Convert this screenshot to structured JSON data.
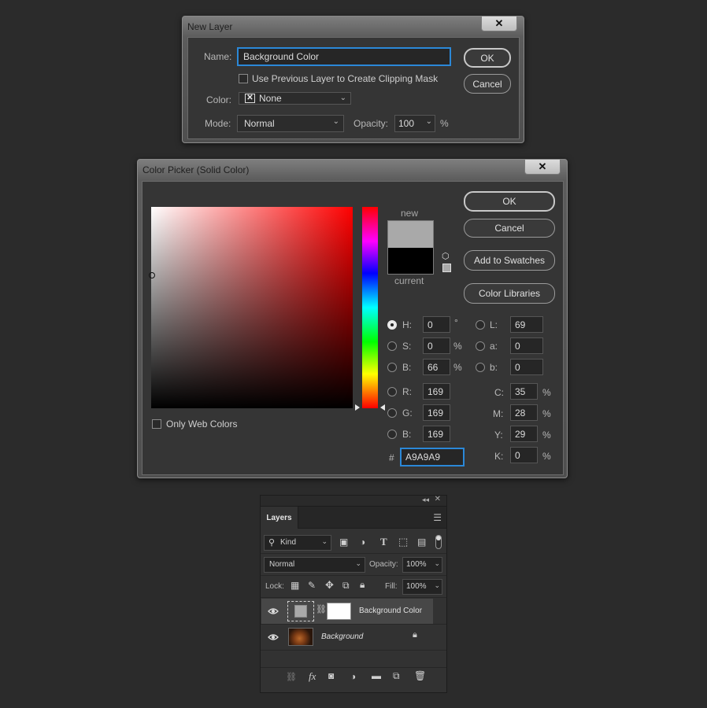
{
  "new_layer": {
    "title": "New Layer",
    "close": "✕",
    "name_label": "Name:",
    "name_value": "Background Color",
    "clip_label": "Use Previous Layer to Create Clipping Mask",
    "color_label": "Color:",
    "color_value": "None",
    "mode_label": "Mode:",
    "mode_value": "Normal",
    "opacity_label": "Opacity:",
    "opacity_value": "100",
    "opacity_unit": "%",
    "ok": "OK",
    "cancel": "Cancel"
  },
  "color_picker": {
    "title": "Color Picker (Solid Color)",
    "close": "✕",
    "new_label": "new",
    "current_label": "current",
    "new_color": "#a9a9a9",
    "current_color": "#000000",
    "hue_color": "#ff0000",
    "ok": "OK",
    "cancel": "Cancel",
    "add_swatches": "Add to Swatches",
    "color_libraries": "Color Libraries",
    "only_web": "Only Web Colors",
    "h_label": "H:",
    "h_value": "0",
    "h_unit": "°",
    "s_label": "S:",
    "s_value": "0",
    "s_unit": "%",
    "b_label": "B:",
    "b_value": "66",
    "b_unit": "%",
    "r_label": "R:",
    "r_value": "169",
    "g_label": "G:",
    "g_value": "169",
    "bb_label": "B:",
    "bb_value": "169",
    "l_label": "L:",
    "l_value": "69",
    "a_label": "a:",
    "a_value": "0",
    "blab_label": "b:",
    "blab_value": "0",
    "c_label": "C:",
    "c_value": "35",
    "c_unit": "%",
    "m_label": "M:",
    "m_value": "28",
    "m_unit": "%",
    "y_label": "Y:",
    "y_value": "29",
    "y_unit": "%",
    "k_label": "K:",
    "k_value": "0",
    "k_unit": "%",
    "hash": "#",
    "hex_value": "A9A9A9"
  },
  "layers": {
    "tab": "Layers",
    "filter_kind": "Kind",
    "blend_mode": "Normal",
    "opacity_label": "Opacity:",
    "opacity_value": "100%",
    "lock_label": "Lock:",
    "fill_label": "Fill:",
    "fill_value": "100%",
    "items": [
      {
        "name": "Background Color"
      },
      {
        "name": "Background"
      }
    ]
  }
}
